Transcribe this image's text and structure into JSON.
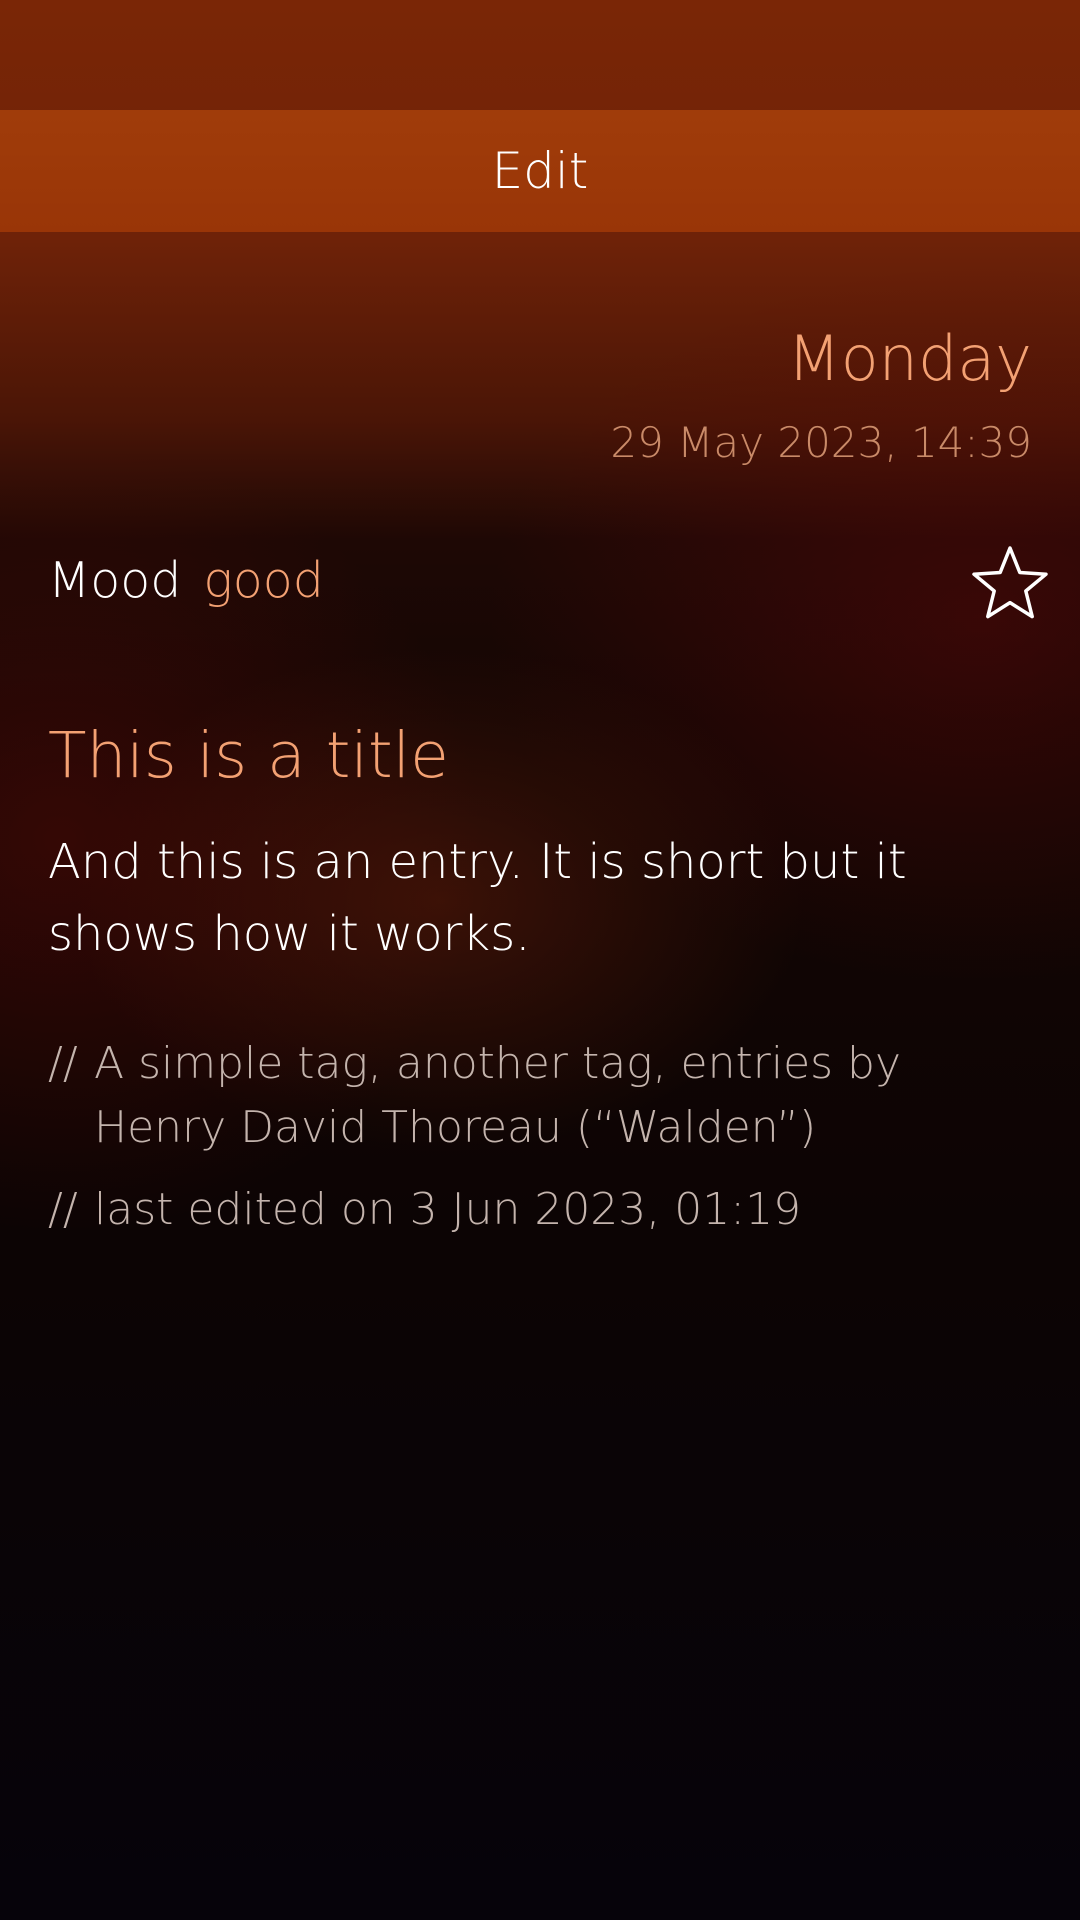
{
  "colors": {
    "accent": "#f3a173",
    "edit_bar": "#a03c0a",
    "secondary_text": "#c4b4ad"
  },
  "header": {
    "edit_label": "Edit"
  },
  "entry": {
    "day_name": "Monday",
    "date_time": "29 May 2023, 14:39",
    "mood_label": "Mood",
    "mood_value": "good",
    "favorite_icon": "star-outline-icon",
    "title": "This is a title",
    "body": "And this is an entry. It is short but it shows how it works.",
    "tags_prefix": "//",
    "tags": "A simple tag, another tag, entries by Henry David Thoreau (“Walden”)",
    "last_edited_prefix": "//",
    "last_edited": "last edited on 3 Jun 2023, 01:19"
  }
}
